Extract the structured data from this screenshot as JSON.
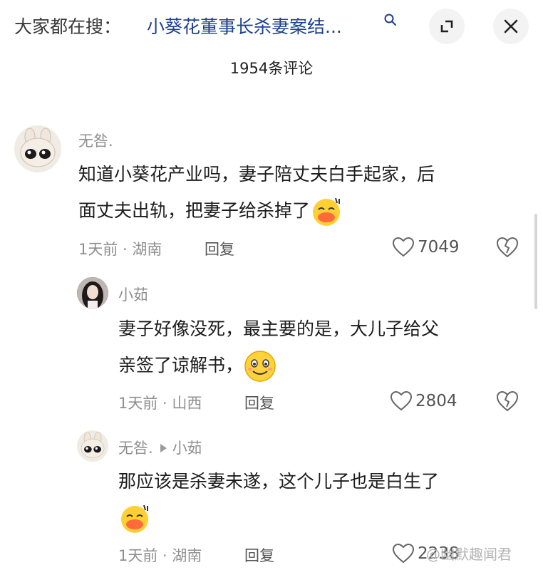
{
  "header": {
    "search_prefix": "大家都在搜：",
    "search_query": "小葵花董事长杀妻案结...",
    "search_icon": "search-icon",
    "shrink_icon": "shrink-window-icon",
    "close_icon": "close-icon"
  },
  "comment_count": "1954条评论",
  "comments": [
    {
      "username": "无咎.",
      "line1": "知道小葵花产业吗，妻子陪丈夫白手起家，后",
      "line2": "面丈夫出轨，把妻子给杀掉了",
      "emoji": "laughing-emoji",
      "time": "1天前",
      "location": "湖南",
      "reply_label": "回复",
      "likes": "7049"
    }
  ],
  "replies": [
    {
      "username": "小茹",
      "line1": "妻子好像没死，最主要的是，大儿子给父",
      "line2": "亲签了谅解书，",
      "emoji": "smile-emoji",
      "time": "1天前",
      "location": "山西",
      "reply_label": "回复",
      "likes": "2804"
    },
    {
      "username": "无咎.",
      "reply_to": "小茹",
      "line1": "那应该是杀妻未遂，这个儿子也是白生了",
      "emoji": "laughing-emoji",
      "time": "1天前",
      "location": "湖南",
      "reply_label": "回复",
      "likes": "2238"
    }
  ],
  "watermark": "@幽默趣闻君",
  "colors": {
    "query_link": "#1f3f8f",
    "meta_gray": "#8f8f8f"
  }
}
